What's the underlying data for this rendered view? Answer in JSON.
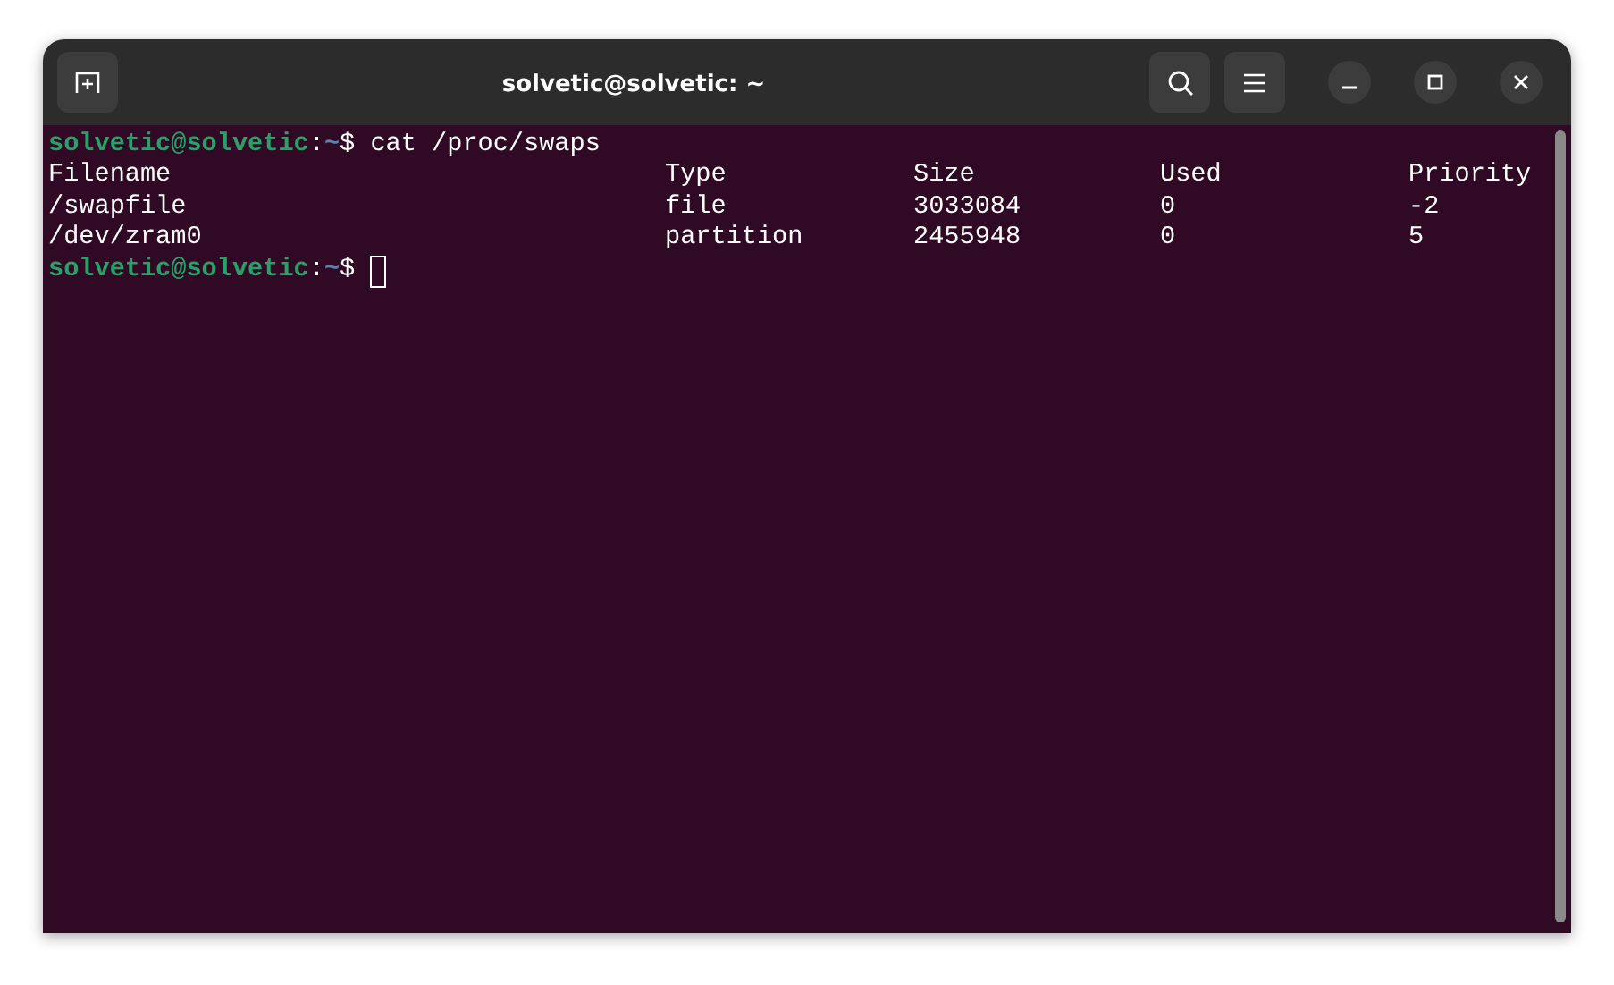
{
  "window": {
    "title": "solvetic@solvetic: ~"
  },
  "terminal": {
    "lines": [
      {
        "kind": "prompt",
        "user": "solvetic@solvetic",
        "separator": ":",
        "path": "~",
        "symbol": "$",
        "command": "cat /proc/swaps",
        "cursor": false
      },
      {
        "kind": "table",
        "columns": [
          "Filename",
          "Type",
          "Size",
          "Used",
          "Priority"
        ],
        "rows": [
          [
            "/swapfile",
            "file",
            "3033084",
            "0",
            "-2"
          ],
          [
            "/dev/zram0",
            "partition",
            "2455948",
            "0",
            "5"
          ]
        ]
      },
      {
        "kind": "prompt",
        "user": "solvetic@solvetic",
        "separator": ":",
        "path": "~",
        "symbol": "$",
        "cursor": true
      }
    ]
  }
}
